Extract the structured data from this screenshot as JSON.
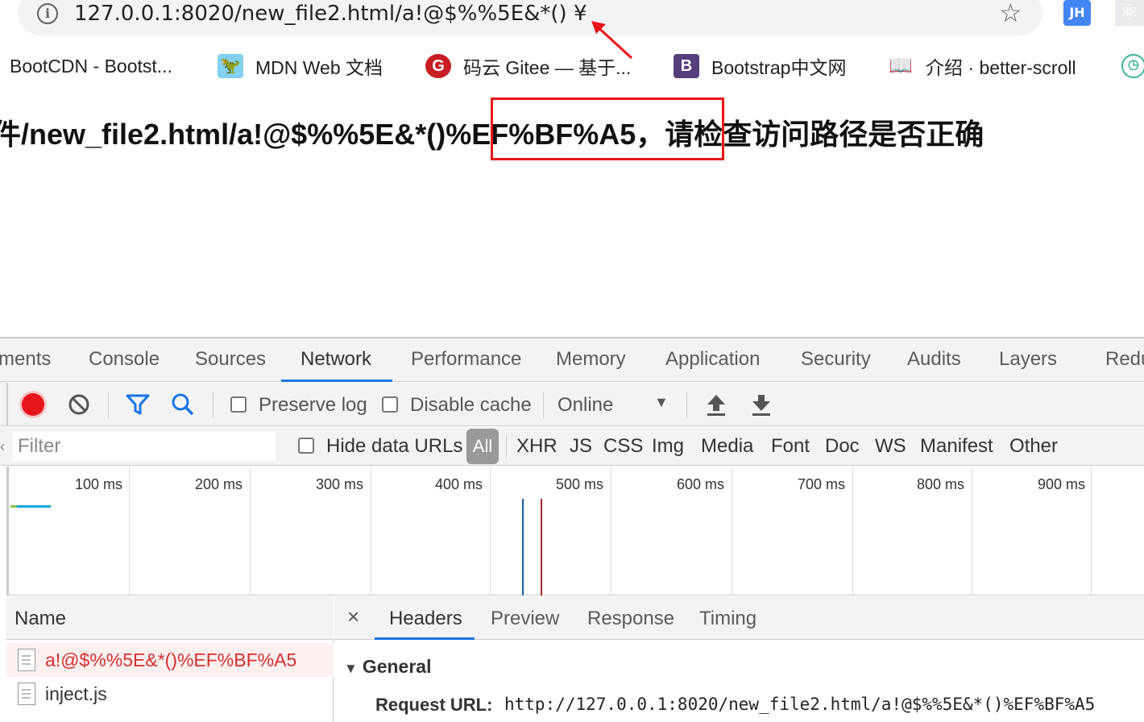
{
  "browser": {
    "url": "127.0.0.1:8020/new_file2.html/a!@$%%5E&*() ¥",
    "extension_jh": "JH",
    "bookmarks": [
      {
        "label": "BootCDN - Bootst...",
        "icon": ""
      },
      {
        "label": "MDN Web 文档",
        "icon": "mdn-dino-icon"
      },
      {
        "label": "码云 Gitee — 基于...",
        "icon": "gitee-icon"
      },
      {
        "label": "Bootstrap中文网",
        "icon": "B"
      },
      {
        "label": "介绍 · better-scroll",
        "icon": "book-icon"
      }
    ]
  },
  "page": {
    "heading_before": "件/new_file2.html/a!@$%%5E&*()",
    "heading_highlight": "%EF%BF%A5，",
    "heading_after": "请检查访问路径是否正确",
    "highlight_color": "#e8141b"
  },
  "devtools": {
    "tabs": [
      "ments",
      "Console",
      "Sources",
      "Network",
      "Performance",
      "Memory",
      "Application",
      "Security",
      "Audits",
      "Layers",
      "Redu"
    ],
    "active_tab": "Network",
    "toolbar": {
      "preserve_log": "Preserve log",
      "disable_cache": "Disable cache",
      "throttle": "Online"
    },
    "filter": {
      "placeholder": "Filter",
      "hide_data_urls": "Hide data URLs",
      "types": [
        "All",
        "XHR",
        "JS",
        "CSS",
        "Img",
        "Media",
        "Font",
        "Doc",
        "WS",
        "Manifest",
        "Other"
      ]
    },
    "timeline_ticks": [
      "100 ms",
      "200 ms",
      "300 ms",
      "400 ms",
      "500 ms",
      "600 ms",
      "700 ms",
      "800 ms",
      "900 ms"
    ],
    "requests_header": "Name",
    "requests": [
      {
        "name": "a!@$%%5E&*()%EF%BF%A5",
        "status": "error"
      },
      {
        "name": "inject.js",
        "status": "ok"
      }
    ],
    "detail_tabs": [
      "Headers",
      "Preview",
      "Response",
      "Timing"
    ],
    "general": {
      "title": "General",
      "request_url_label": "Request URL:",
      "request_url": "http://127.0.0.1:8020/new_file2.html/a!@$%%5E&*()%EF%BF%A5"
    }
  }
}
